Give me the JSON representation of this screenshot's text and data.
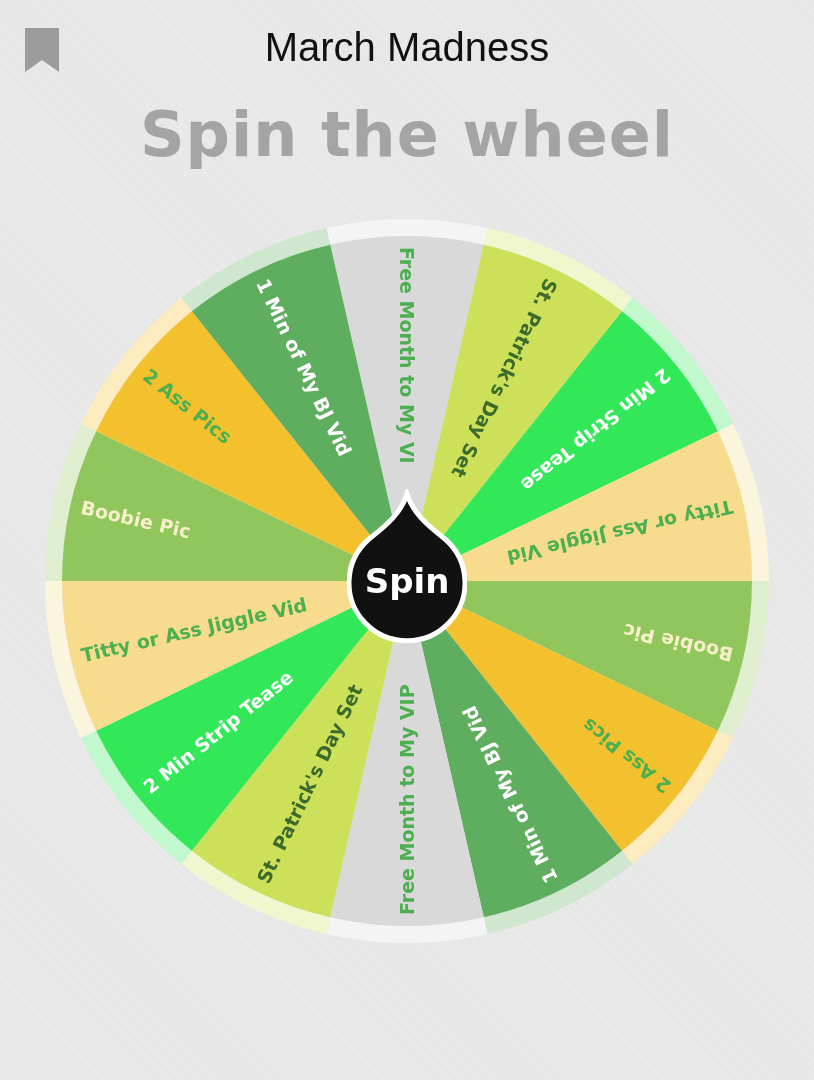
{
  "header": {
    "title": "March Madness"
  },
  "heading": "Spin the wheel",
  "wheel": {
    "segments": [
      {
        "label": "Free Month to My VI",
        "color": "#d9d9d9",
        "kind": "green"
      },
      {
        "label": "St. Patrick's Day Set",
        "color": "#cde05a",
        "kind": "dark"
      },
      {
        "label": "2 Min Strip Tease",
        "color": "#33e858",
        "kind": "white"
      },
      {
        "label": "Titty or Ass Jiggle Vid",
        "color": "#f6dc8c",
        "kind": "green"
      },
      {
        "label": "Boobie Pic",
        "color": "#90c65c",
        "kind": "cream"
      },
      {
        "label": "2 Ass Pics",
        "color": "#f4c12e",
        "kind": "green"
      },
      {
        "label": "1 Min of My BJ Vid",
        "color": "#5fae5f",
        "kind": "white"
      },
      {
        "label": "Free Month to My VIP",
        "color": "#d9d9d9",
        "kind": "green"
      },
      {
        "label": "St. Patrick's Day Set",
        "color": "#cde05a",
        "kind": "dark"
      },
      {
        "label": "2 Min Strip Tease",
        "color": "#33e858",
        "kind": "white"
      },
      {
        "label": "Titty or Ass Jiggle Vid",
        "color": "#f6dc8c",
        "kind": "green"
      },
      {
        "label": "Boobie Pic",
        "color": "#90c65c",
        "kind": "cream"
      },
      {
        "label": "2 Ass Pics",
        "color": "#f4c12e",
        "kind": "green"
      },
      {
        "label": "1 Min of My BJ Vid",
        "color": "#5fae5f",
        "kind": "white"
      }
    ],
    "spin_button": "Spin"
  }
}
